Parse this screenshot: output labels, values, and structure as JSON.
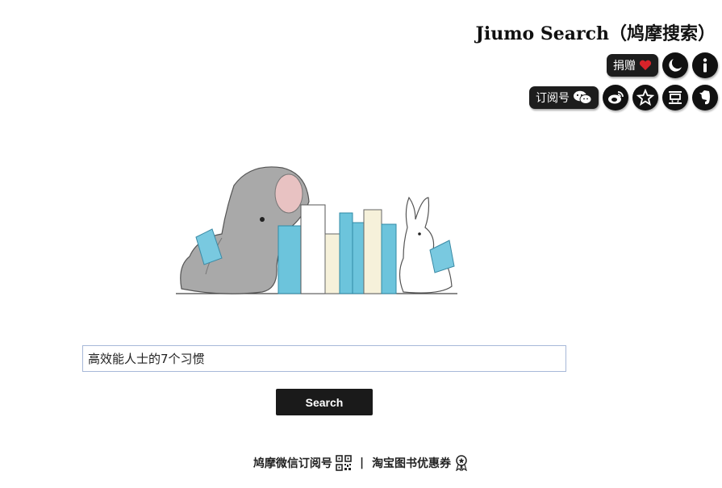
{
  "header": {
    "title": "Jiumo Search（鸠摩搜索）"
  },
  "toolbar": {
    "donate_label": "捐赠",
    "subscribe_label": "订阅号"
  },
  "search": {
    "value": "高效能人士的7个习惯",
    "button_label": "Search"
  },
  "footer": {
    "wechat_link": "鸠摩微信订阅号",
    "separator": "|",
    "coupon_link": "淘宝图书优惠券"
  },
  "icons": {
    "heart": "heart-icon",
    "moon": "moon-icon",
    "info": "info-icon",
    "wechat": "wechat-icon",
    "weibo": "weibo-icon",
    "star": "star-icon",
    "douban": "douban-icon",
    "evernote": "evernote-icon",
    "qrcode": "qrcode-icon",
    "badge": "badge-icon"
  },
  "colors": {
    "accent_dark": "#1a1a1a",
    "heart": "#d8232a",
    "input_border": "#a7b8d8"
  }
}
